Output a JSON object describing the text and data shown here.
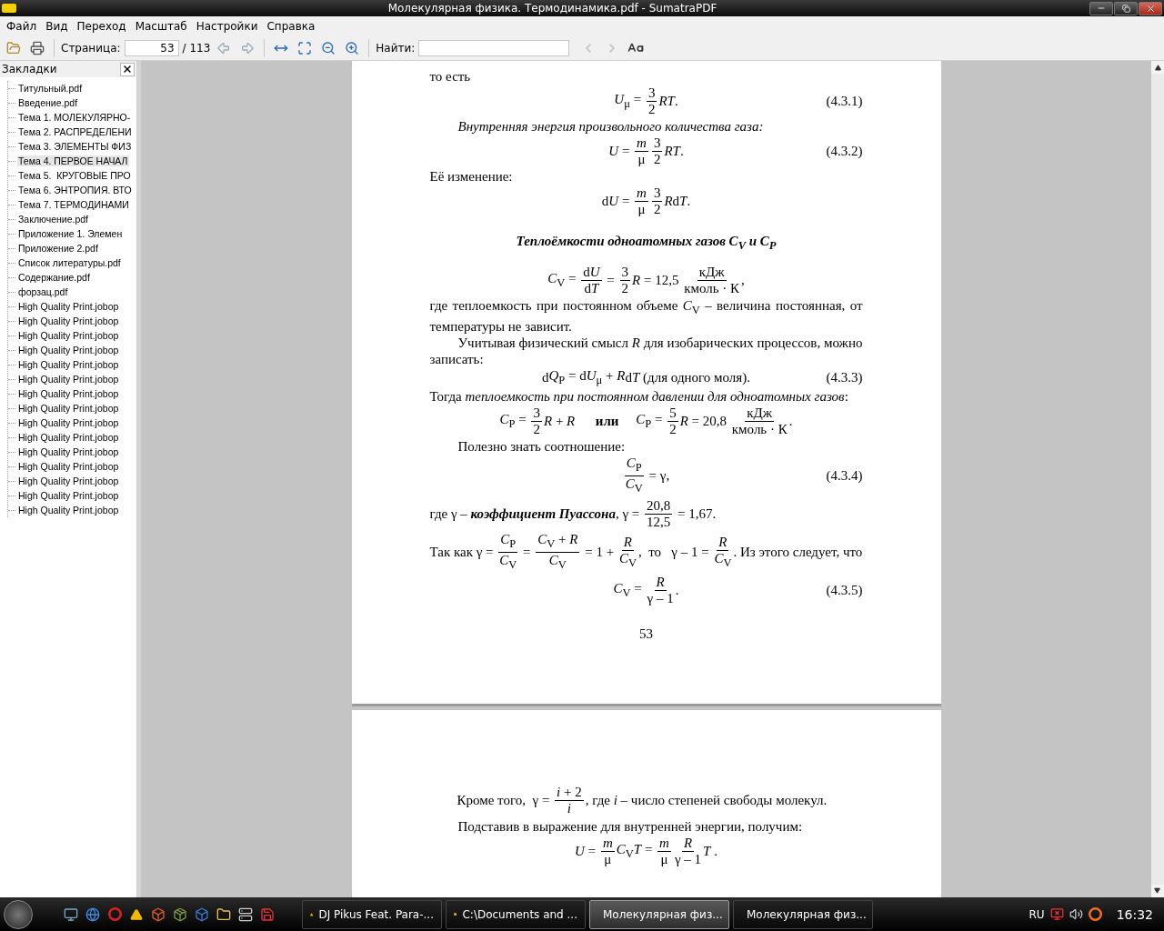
{
  "window": {
    "title": "Молекулярная физика. Термодинамика.pdf - SumatraPDF"
  },
  "menu": [
    "Файл",
    "Вид",
    "Переход",
    "Масштаб",
    "Настройки",
    "Справка"
  ],
  "toolbar": {
    "page_label": "Страница:",
    "page_value": "53",
    "page_total": "/ 113",
    "find_label": "Найти:"
  },
  "sidebar": {
    "title": "Закладки",
    "items": [
      {
        "label": "Титульный.pdf",
        "selected": false
      },
      {
        "label": "Введение.pdf",
        "selected": false
      },
      {
        "label": "Тема 1. МОЛЕКУЛЯРНО-",
        "selected": false
      },
      {
        "label": "Тема 2. РАСПРЕДЕЛЕНИ",
        "selected": false
      },
      {
        "label": "Тема 3. ЭЛЕМЕНТЫ ФИЗ",
        "selected": false
      },
      {
        "label": "Тема 4. ПЕРВОЕ НАЧАЛ",
        "selected": true
      },
      {
        "label": "Тема 5.  КРУГОВЫЕ ПРО",
        "selected": false
      },
      {
        "label": "Тема 6. ЭНТРОПИЯ. ВТО",
        "selected": false
      },
      {
        "label": "Тема 7. ТЕРМОДИНАМИ",
        "selected": false
      },
      {
        "label": "Заключение.pdf",
        "selected": false
      },
      {
        "label": "Приложение 1. Элемен",
        "selected": false
      },
      {
        "label": "Приложение 2.pdf",
        "selected": false
      },
      {
        "label": "Список литературы.pdf",
        "selected": false
      },
      {
        "label": "Содержание.pdf",
        "selected": false
      },
      {
        "label": "форзац.pdf",
        "selected": false
      },
      {
        "label": "High Quality Print.jobop",
        "selected": false
      },
      {
        "label": "High Quality Print.jobop",
        "selected": false
      },
      {
        "label": "High Quality Print.jobop",
        "selected": false
      },
      {
        "label": "High Quality Print.jobop",
        "selected": false
      },
      {
        "label": "High Quality Print.jobop",
        "selected": false
      },
      {
        "label": "High Quality Print.jobop",
        "selected": false
      },
      {
        "label": "High Quality Print.jobop",
        "selected": false
      },
      {
        "label": "High Quality Print.jobop",
        "selected": false
      },
      {
        "label": "High Quality Print.jobop",
        "selected": false
      },
      {
        "label": "High Quality Print.jobop",
        "selected": false
      },
      {
        "label": "High Quality Print.jobop",
        "selected": false
      },
      {
        "label": "High Quality Print.jobop",
        "selected": false
      },
      {
        "label": "High Quality Print.jobop",
        "selected": false
      },
      {
        "label": "High Quality Print.jobop",
        "selected": false
      },
      {
        "label": "High Quality Print.jobop",
        "selected": false
      }
    ]
  },
  "document": {
    "pages": [
      {
        "page_number": "53",
        "blocks": [
          {
            "kind": "text",
            "text": "то есть",
            "indent": false
          },
          {
            "kind": "formula",
            "number": "(4.3.1)",
            "pieces": [
              {
                "t": "*U*$_{μ}$ = "
              },
              {
                "num": "3",
                "den": "2"
              },
              {
                "t": "*RT*."
              }
            ]
          },
          {
            "kind": "italic-text",
            "text": "Внутренняя энергия произвольного количества газа:",
            "indent": true
          },
          {
            "kind": "formula",
            "number": "(4.3.2)",
            "pieces": [
              {
                "t": "*U* = "
              },
              {
                "num": "*m*",
                "den": "μ"
              },
              {
                "num": "3",
                "den": "2"
              },
              {
                "t": "*RT*."
              }
            ]
          },
          {
            "kind": "text",
            "text": "Её изменение:",
            "indent": false
          },
          {
            "kind": "formula",
            "pieces": [
              {
                "t": "d"
              },
              {
                "t": "*U* = "
              },
              {
                "num": "*m*",
                "den": "μ"
              },
              {
                "num": "3",
                "den": "2"
              },
              {
                "t": "*R*"
              },
              {
                "t": "d"
              },
              {
                "t": "*T*."
              }
            ]
          },
          {
            "kind": "heading",
            "text": "Теплоёмкости одноатомных газов C$_{V}$ и C$_{P}$"
          },
          {
            "kind": "formula",
            "pieces": [
              {
                "t": "*C*$_{V}$ = "
              },
              {
                "num": [
                  "d",
                  "*U*"
                ],
                "den": [
                  "d",
                  "*T*"
                ]
              },
              {
                "t": " = "
              },
              {
                "num": "3",
                "den": "2"
              },
              {
                "t": "*R* = 12,5 "
              },
              {
                "num": "кДж",
                "den": "кмоль · К"
              },
              {
                "t": ","
              }
            ]
          },
          {
            "kind": "text",
            "text": "где теплоемкость при постоянном объеме *C*$_{V}$ – величина постоянная, от температуры не зависит.",
            "indent": false
          },
          {
            "kind": "text",
            "text": "Учитывая физический смысл *R* для изобарических процессов, можно записать:",
            "indent": true
          },
          {
            "kind": "formula",
            "number": "(4.3.3)",
            "pieces": [
              {
                "t": "d"
              },
              {
                "t": "*Q*$_{P}$ = d"
              },
              {
                "t": "*U*$_{μ}$ + *R*"
              },
              {
                "t": "d"
              },
              {
                "t": "*T* "
              },
              {
                "t": "(для одного моля)."
              }
            ]
          },
          {
            "kind": "text",
            "text": "Тогда *теплоемкость при постоянном давлении для одноатомных газов*:",
            "indent": false
          },
          {
            "kind": "formula",
            "pieces": [
              {
                "t": "*C*$_{P}$ = "
              },
              {
                "num": "3",
                "den": "2"
              },
              {
                "t": "*R* + *R*      "
              },
              {
                "t": "**или**"
              },
              {
                "t": "     *C*$_{P}$ = "
              },
              {
                "num": "5",
                "den": "2"
              },
              {
                "t": "*R* = 20,8 "
              },
              {
                "num": "кДж",
                "den": "кмоль · К"
              },
              {
                "t": "."
              }
            ]
          },
          {
            "kind": "text",
            "text": "Полезно знать соотношение:",
            "indent": true
          },
          {
            "kind": "formula",
            "number": "(4.3.4)",
            "pieces": [
              {
                "num": "*C*$_{P}$",
                "den": "*C*$_{V}$"
              },
              {
                "t": " = γ,"
              }
            ]
          },
          {
            "kind": "inline-formula",
            "pieces": [
              {
                "t": "где γ – **коэффициент Пуассона**, γ = "
              },
              {
                "num": "20,8",
                "den": "12,5"
              },
              {
                "t": " = 1,67."
              }
            ]
          },
          {
            "kind": "inline-formula",
            "pieces": [
              {
                "t": "Так как γ = "
              },
              {
                "num": "*C*$_{P}$",
                "den": "*C*$_{V}$"
              },
              {
                "t": " = "
              },
              {
                "num": "*C*$_{V}$ + *R*",
                "den": "*C*$_{V}$"
              },
              {
                "t": " = 1 + "
              },
              {
                "num": "*R*",
                "den": "*C*$_{V}$"
              },
              {
                "t": ",  то   γ – 1 = "
              },
              {
                "num": "*R*",
                "den": "*C*$_{V}$"
              },
              {
                "t": ". Из этого следует, что"
              }
            ]
          },
          {
            "kind": "formula",
            "number": "(4.3.5)",
            "pieces": [
              {
                "t": "*C*$_{V}$ = "
              },
              {
                "num": "*R*",
                "den": "γ – 1"
              },
              {
                "t": "."
              }
            ]
          }
        ]
      },
      {
        "blocks": [
          {
            "kind": "indented-formula",
            "pieces": [
              {
                "t": "Кроме того,  γ = "
              },
              {
                "num": "*i* + 2",
                "den": "*i*"
              },
              {
                "t": ", где *i* – число степеней свободы молекул."
              }
            ]
          },
          {
            "kind": "text",
            "text": "Подставив в выражение для внутренней энергии, получим:",
            "indent": true
          },
          {
            "kind": "formula",
            "pieces": [
              {
                "t": "*U* = "
              },
              {
                "num": "*m*",
                "den": "μ"
              },
              {
                "t": "*C*$_{V}$*T* = "
              },
              {
                "num": "*m*",
                "den": "μ"
              },
              {
                "num": "*R*",
                "den": "γ – 1"
              },
              {
                "t": "*T* ."
              }
            ]
          }
        ]
      }
    ]
  },
  "taskbar": {
    "tasks": [
      {
        "kind": "player",
        "label": "DJ Pikus Feat. Para-...",
        "selected": false
      },
      {
        "kind": "folder",
        "label": "C:\\Documents and ...",
        "selected": false
      },
      {
        "kind": "pdf",
        "label": "Молекулярная физ...",
        "selected": true
      },
      {
        "kind": "word",
        "label": "Молекулярная физ...",
        "selected": false
      }
    ],
    "language": "RU",
    "clock": "16:32"
  }
}
